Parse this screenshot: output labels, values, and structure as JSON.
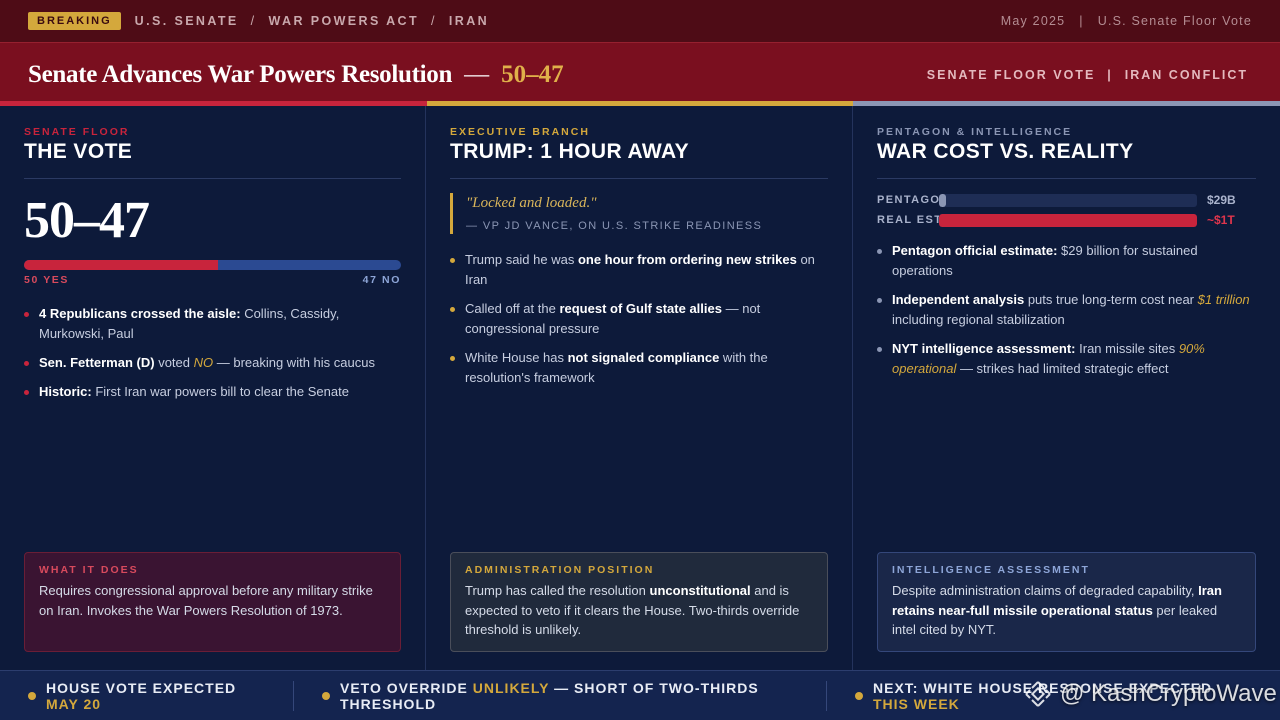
{
  "topbar": {
    "badge": "BREAKING",
    "crumbs": [
      "U.S. SENATE",
      "WAR POWERS ACT",
      "IRAN"
    ],
    "crumb_sep": "/",
    "date": "May 2025",
    "sep": "|",
    "source": "U.S. Senate Floor Vote"
  },
  "header": {
    "title": "Senate Advances War Powers Resolution",
    "dash": "—",
    "score": "50–47",
    "tags": [
      "SENATE FLOOR VOTE",
      "IRAN CONFLICT"
    ],
    "tag_sep": "|"
  },
  "colors": {
    "red": "#c8243c",
    "gold": "#d4a83c",
    "blue": "#2b4a92",
    "slate": "#8b96b4"
  },
  "vote": {
    "kicker": "SENATE FLOOR",
    "title": "THE VOTE",
    "score": "50–47",
    "yes": 50,
    "no": 47,
    "yes_label": "50 YES",
    "no_label": "47 NO",
    "bullets": [
      {
        "bold": "4 Republicans crossed the aisle:",
        "text": " Collins, Cassidy, Murkowski, Paul"
      },
      {
        "bold": "Sen. Fetterman (D)",
        "text": " voted ",
        "ital": "NO",
        "after": " — breaking with his caucus"
      },
      {
        "bold": "Historic:",
        "text": " First Iran war powers bill to clear the Senate"
      }
    ],
    "box_title": "WHAT IT DOES",
    "box_body": "Requires congressional approval before any military strike on Iran. Invokes the War Powers Resolution of 1973."
  },
  "exec": {
    "kicker": "EXECUTIVE BRANCH",
    "title": "TRUMP: 1 HOUR AWAY",
    "quote": "\"Locked and loaded.\"",
    "quote_attr": "— VP JD VANCE, ON U.S. STRIKE READINESS",
    "bullets": [
      {
        "pre": "Trump said he was ",
        "bold": "one hour from ordering new strikes",
        "post": " on Iran"
      },
      {
        "pre": "Called off at the ",
        "bold": "request of Gulf state allies",
        "post": " — not congressional pressure"
      },
      {
        "pre": "White House has ",
        "bold": "not signaled compliance",
        "post": " with the resolution's framework"
      }
    ],
    "box_title": "ADMINISTRATION POSITION",
    "box_pre": "Trump has called the resolution ",
    "box_bold": "unconstitutional",
    "box_post": " and is expected to veto if it clears the House. Two-thirds override threshold is unlikely."
  },
  "cost": {
    "kicker": "PENTAGON & INTELLIGENCE",
    "title": "WAR COST VS. REALITY",
    "bars": [
      {
        "label": "PENTAGON",
        "value": "$29B",
        "fraction": 0.029,
        "color": "#8b96b4"
      },
      {
        "label": "REAL EST.",
        "value": "~$1T",
        "fraction": 1.0,
        "color": "#c8243c"
      }
    ],
    "bullets": [
      {
        "bold": "Pentagon official estimate:",
        "text": " $29 billion for sustained operations"
      },
      {
        "bold": "Independent analysis",
        "text": " puts true long-term cost near ",
        "ital": "$1 trillion",
        "after": " including regional stabilization"
      },
      {
        "bold": "NYT intelligence assessment:",
        "text": " Iran missile sites ",
        "ital": "90% operational",
        "after": " — strikes had limited strategic effect"
      }
    ],
    "box_title": "INTELLIGENCE ASSESSMENT",
    "box_pre": "Despite administration claims of degraded capability, ",
    "box_bold": "Iran retains near-full missile operational status",
    "box_post": " per leaked intel cited by NYT."
  },
  "ticker": [
    {
      "line1": "HOUSE VOTE EXPECTED",
      "line2": "MAY 20"
    },
    {
      "pre": "VETO OVERRIDE ",
      "gold": "UNLIKELY",
      "post": " — SHORT OF TWO-THIRDS",
      "line2": "THRESHOLD"
    },
    {
      "line1": "NEXT: WHITE HOUSE RESPONSE EXPECTED",
      "line2": "THIS WEEK"
    }
  ],
  "watermark": {
    "handle": "@ KashCryptoWave",
    "icon": "binance-logo-icon"
  }
}
